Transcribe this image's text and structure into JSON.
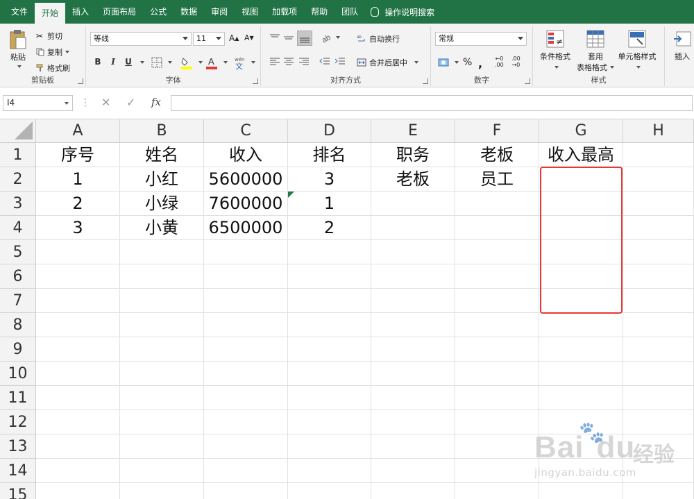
{
  "tabs": [
    {
      "label": "文件",
      "active": false
    },
    {
      "label": "开始",
      "active": true
    },
    {
      "label": "插入",
      "active": false
    },
    {
      "label": "页面布局",
      "active": false
    },
    {
      "label": "公式",
      "active": false
    },
    {
      "label": "数据",
      "active": false
    },
    {
      "label": "审阅",
      "active": false
    },
    {
      "label": "视图",
      "active": false
    },
    {
      "label": "加载项",
      "active": false
    },
    {
      "label": "帮助",
      "active": false
    },
    {
      "label": "团队",
      "active": false
    }
  ],
  "tell_me": "操作说明搜索",
  "ribbon": {
    "clipboard": {
      "label": "剪贴板",
      "paste": "粘贴",
      "cut": "剪切",
      "copy": "复制",
      "format_painter": "格式刷"
    },
    "font": {
      "label": "字体",
      "name": "等线",
      "size": "11",
      "bold": "B",
      "italic": "I",
      "underline": "U"
    },
    "alignment": {
      "label": "对齐方式",
      "wrap": "自动换行",
      "merge": "合并后居中"
    },
    "number": {
      "label": "数字",
      "format": "常规"
    },
    "styles": {
      "label": "样式",
      "conditional": "条件格式",
      "table_fmt_1": "套用",
      "table_fmt_2": "表格格式",
      "cell_styles": "单元格样式"
    },
    "cells": {
      "insert": "插入"
    }
  },
  "formula_bar": {
    "name_box": "I4",
    "cancel": "✕",
    "enter": "✓",
    "fx": "fx",
    "content": ""
  },
  "columns": [
    "A",
    "B",
    "C",
    "D",
    "E",
    "F",
    "G",
    "H"
  ],
  "rows": [
    "1",
    "2",
    "3",
    "4",
    "5",
    "6",
    "7",
    "8",
    "9",
    "10",
    "11",
    "12",
    "13",
    "14",
    "15"
  ],
  "cells": {
    "A1": "序号",
    "B1": "姓名",
    "C1": "收入",
    "D1": "排名",
    "E1": "职务",
    "F1": "老板",
    "G1": "收入最高",
    "A2": "1",
    "B2": "小红",
    "C2": "5600000",
    "D2": "3",
    "E2": "老板",
    "F2": "员工",
    "A3": "2",
    "B3": "小绿",
    "C3": "7600000",
    "D3": "1",
    "A4": "3",
    "B4": "小黄",
    "C4": "6500000",
    "D4": "2"
  },
  "watermark": {
    "logo": "Bai",
    "logo2": "du",
    "cn": "经验",
    "url": "jingyan.baidu.com"
  },
  "colors": {
    "brand": "#217346",
    "highlight": "#e53935"
  }
}
